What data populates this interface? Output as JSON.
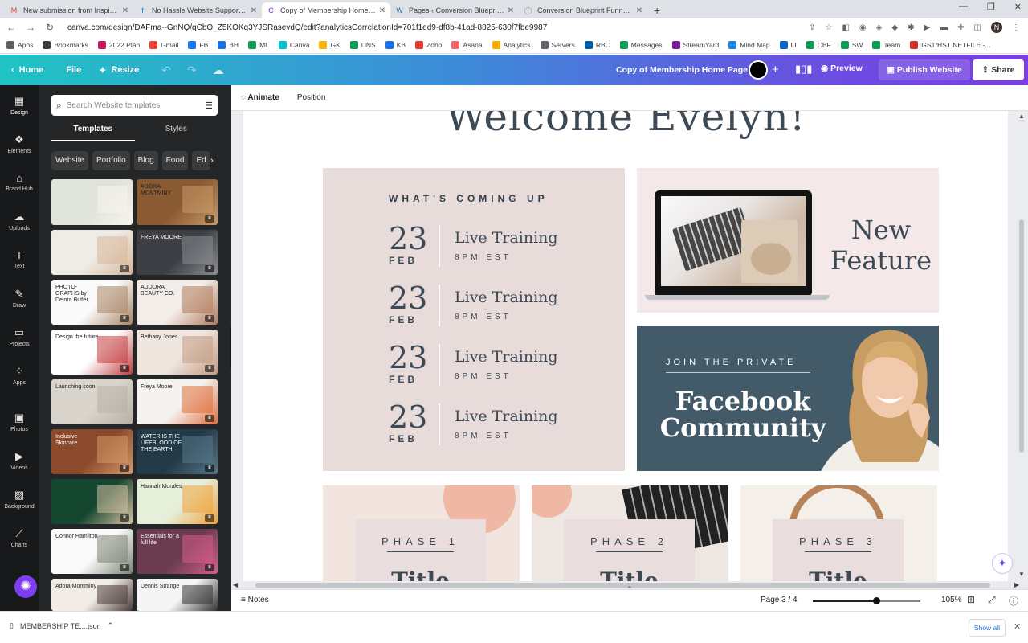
{
  "browser": {
    "tabs": [
      {
        "title": "New submission from Inspiration",
        "icon": "gmail-icon",
        "color": "#ea4335",
        "glyph": "M"
      },
      {
        "title": "No Hassle Website Support & M",
        "icon": "facebook-icon",
        "color": "#1877f2",
        "glyph": "f"
      },
      {
        "title": "Copy of Membership Home Page",
        "icon": "canva-icon",
        "color": "#7d2ae8",
        "glyph": "C"
      },
      {
        "title": "Pages ‹ Conversion Blueprint Fu",
        "icon": "wordpress-icon",
        "color": "#21759b",
        "glyph": "W"
      },
      {
        "title": "Conversion Blueprint Funnels Inc",
        "icon": "globe-icon",
        "color": "#9aa0a6",
        "glyph": "◯"
      }
    ],
    "active_tab": 2,
    "url": "canva.com/design/DAFma--GnNQ/qCbO_Z5KOKq3YJSRasevdQ/edit?analyticsCorrelationId=701f1ed9-df8b-41ad-8825-630f7fbe9987",
    "profile_initial": "N",
    "bookmarks": [
      {
        "label": "Apps",
        "color": "#5f6368"
      },
      {
        "label": "Bookmarks",
        "color": "#3c4043"
      },
      {
        "label": "2022 Plan",
        "color": "#c2185b"
      },
      {
        "label": "Gmail",
        "color": "#ea4335"
      },
      {
        "label": "FB",
        "color": "#1877f2"
      },
      {
        "label": "BH",
        "color": "#1a73e8"
      },
      {
        "label": "ML",
        "color": "#0f9d58"
      },
      {
        "label": "Canva",
        "color": "#00c4cc"
      },
      {
        "label": "GK",
        "color": "#f4b400"
      },
      {
        "label": "DNS",
        "color": "#0f9d58"
      },
      {
        "label": "KB",
        "color": "#1a73e8"
      },
      {
        "label": "Zoho",
        "color": "#e53935"
      },
      {
        "label": "Asana",
        "color": "#f06a6a"
      },
      {
        "label": "Analytics",
        "color": "#f9ab00"
      },
      {
        "label": "Servers",
        "color": "#5f6368"
      },
      {
        "label": "RBC",
        "color": "#005daa"
      },
      {
        "label": "Messages",
        "color": "#0f9d58"
      },
      {
        "label": "StreamYard",
        "color": "#7b1fa2"
      },
      {
        "label": "Mind Map",
        "color": "#1e88e5"
      },
      {
        "label": "LI",
        "color": "#0a66c2"
      },
      {
        "label": "CBF",
        "color": "#0f9d58"
      },
      {
        "label": "SW",
        "color": "#0f9d58"
      },
      {
        "label": "Team",
        "color": "#0f9d58"
      },
      {
        "label": "GST/HST NETFILE -...",
        "color": "#d32f2f"
      }
    ]
  },
  "canva": {
    "home": "Home",
    "file": "File",
    "resize": "Resize",
    "doc_title": "Copy of Membership Home Page",
    "preview": "Preview",
    "publish": "Publish Website",
    "share": "Share",
    "context": {
      "animate": "Animate",
      "position": "Position"
    },
    "rail": [
      {
        "label": "Design",
        "icon": "design-icon",
        "glyph": "▦"
      },
      {
        "label": "Elements",
        "icon": "elements-icon",
        "glyph": "❖"
      },
      {
        "label": "Brand Hub",
        "icon": "brand-hub-icon",
        "glyph": "⌂"
      },
      {
        "label": "Uploads",
        "icon": "uploads-icon",
        "glyph": "☁"
      },
      {
        "label": "Text",
        "icon": "text-icon",
        "glyph": "T"
      },
      {
        "label": "Draw",
        "icon": "draw-icon",
        "glyph": "✎"
      },
      {
        "label": "Projects",
        "icon": "projects-icon",
        "glyph": "▭"
      },
      {
        "label": "Apps",
        "icon": "apps-icon",
        "glyph": "⁘"
      },
      {
        "label": "Photos",
        "icon": "photos-icon",
        "glyph": "▣"
      },
      {
        "label": "Videos",
        "icon": "videos-icon",
        "glyph": "▶"
      },
      {
        "label": "Background",
        "icon": "background-icon",
        "glyph": "▨"
      },
      {
        "label": "Charts",
        "icon": "charts-icon",
        "glyph": "⟋"
      }
    ],
    "panel": {
      "search_placeholder": "Search Website templates",
      "tabs": [
        "Templates",
        "Styles"
      ],
      "chips": [
        "Website",
        "Portfolio",
        "Blog",
        "Food",
        "Ed"
      ],
      "templates": [
        {
          "bg": "#dfe3d9",
          "fg": "#f7f4ee",
          "text": "",
          "crown": false
        },
        {
          "bg": "#8a5a33",
          "fg": "#c99b68",
          "text": "ADORA MONTMINY",
          "crown": true
        },
        {
          "bg": "#eeece4",
          "fg": "#d9b69b",
          "text": "",
          "crown": true
        },
        {
          "bg": "#3c3e43",
          "fg": "#8b8d92",
          "text": "FREYA MOORE",
          "crown": true
        },
        {
          "bg": "#fafafa",
          "fg": "#a88363",
          "text": "PHOTO-GRAPHS by Delora Butler",
          "crown": true
        },
        {
          "bg": "#f3ede9",
          "fg": "#b07a5a",
          "text": "AUDORA BEAUTY CO.",
          "crown": true
        },
        {
          "bg": "#ffffff",
          "fg": "#c23b3b",
          "text": "Design the future",
          "crown": true
        },
        {
          "bg": "#efe6e0",
          "fg": "#c39a7f",
          "text": "Bethany Jones",
          "crown": true
        },
        {
          "bg": "#d9d4cc",
          "fg": "#b8b0a5",
          "text": "Launching soon",
          "crown": false
        },
        {
          "bg": "#f5f3f0",
          "fg": "#e06e3b",
          "text": "Freya Moore",
          "crown": true
        },
        {
          "bg": "#8c4a2c",
          "fg": "#d49a6a",
          "text": "Inclusive Skincare",
          "crown": true
        },
        {
          "bg": "#233a48",
          "fg": "#57788a",
          "text": "WATER IS THE LIFEBLOOD OF THE EARTH.",
          "crown": true
        },
        {
          "bg": "#15462f",
          "fg": "#d9c3a5",
          "text": "",
          "crown": true
        },
        {
          "bg": "#e6efd9",
          "fg": "#f0a23a",
          "text": "Hannah Morales",
          "crown": true
        },
        {
          "bg": "#fafafa",
          "fg": "#7c8473",
          "text": "Connor Hamilton",
          "crown": true
        },
        {
          "bg": "#6b3b4f",
          "fg": "#d75c8c",
          "text": "Essentials for a full life",
          "crown": true
        },
        {
          "bg": "#f1ede6",
          "fg": "#4a3b3b",
          "text": "Adora Montminy",
          "crown": false
        },
        {
          "bg": "#f5f5f5",
          "fg": "#333333",
          "text": "Dennis Strange",
          "crown": false
        }
      ]
    },
    "page": {
      "welcome": "Welcome Evelyn!",
      "coming_heading": "WHAT'S COMING UP",
      "events": [
        {
          "day": "23",
          "month": "FEB",
          "title": "Live Training",
          "time": "8PM EST"
        },
        {
          "day": "23",
          "month": "FEB",
          "title": "Live Training",
          "time": "8PM EST"
        },
        {
          "day": "23",
          "month": "FEB",
          "title": "Live Training",
          "time": "8PM EST"
        },
        {
          "day": "23",
          "month": "FEB",
          "title": "Live Training",
          "time": "8PM EST"
        }
      ],
      "new_feature": "New Feature",
      "join": "JOIN THE PRIVATE",
      "community": "Facebook Community",
      "phases": [
        {
          "label": "PHASE 1",
          "title": "Title",
          "bg": "#f2e4de"
        },
        {
          "label": "PHASE 2",
          "title": "Title",
          "bg": "#efe7e1"
        },
        {
          "label": "PHASE 3",
          "title": "Title",
          "bg": "#f4efe8"
        }
      ]
    },
    "footer": {
      "notes": "Notes",
      "page": "Page 3 / 4",
      "zoom": "105%",
      "zoom_fraction": 0.59
    }
  },
  "downloads": {
    "file": "MEMBERSHIP TE....json",
    "show_all": "Show all"
  },
  "colors": {
    "canva_gradient_start": "#21c3c4",
    "canva_gradient_end": "#7b3fe4",
    "slate": "#435a68",
    "blush": "#e8dcdb"
  }
}
